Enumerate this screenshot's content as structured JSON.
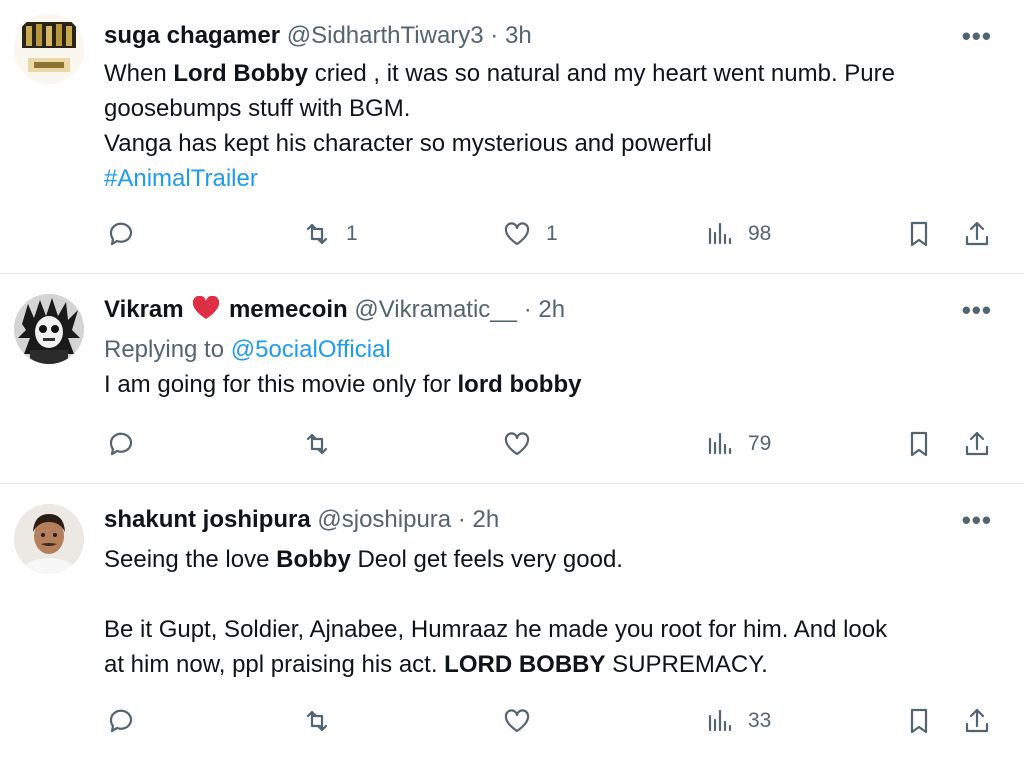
{
  "tweets": [
    {
      "name": "suga chagamer",
      "handle": "@SidharthTiwary3",
      "time": "3h",
      "lines": [
        [
          "When ",
          "Lord Bobby",
          " cried , it was so natural and my heart went numb. Pure"
        ],
        [
          "goosebumps stuff with BGM."
        ],
        [
          "Vanga has kept his character so mysterious and powerful"
        ]
      ],
      "hashtag": "#AnimalTrailer",
      "retweets": "1",
      "likes": "1",
      "views": "98"
    },
    {
      "name": "Vikram",
      "name_suffix": "memecoin",
      "handle": "@Vikramatic__",
      "time": "2h",
      "replying_prefix": "Replying to ",
      "replying_to": "@5ocialOfficial",
      "text_plain": "I am going for this movie only for ",
      "text_bold": "lord bobby",
      "views": "79"
    },
    {
      "name": "shakunt joshipura",
      "handle": "@sjoshipura",
      "time": "2h",
      "line1": [
        "Seeing the love ",
        "Bobby",
        " Deol get feels very good."
      ],
      "line2": "Be it Gupt, Soldier, Ajnabee, Humraaz he made you root for him. And look",
      "line3": [
        "at him now, ppl praising his act. ",
        "LORD BOBBY",
        " SUPREMACY."
      ],
      "views": "33"
    }
  ],
  "separator": "·",
  "more_icon": "more-dots-icon",
  "colors": {
    "link": "#1d9bf0",
    "muted": "#536471",
    "heart": "#e0245e"
  }
}
